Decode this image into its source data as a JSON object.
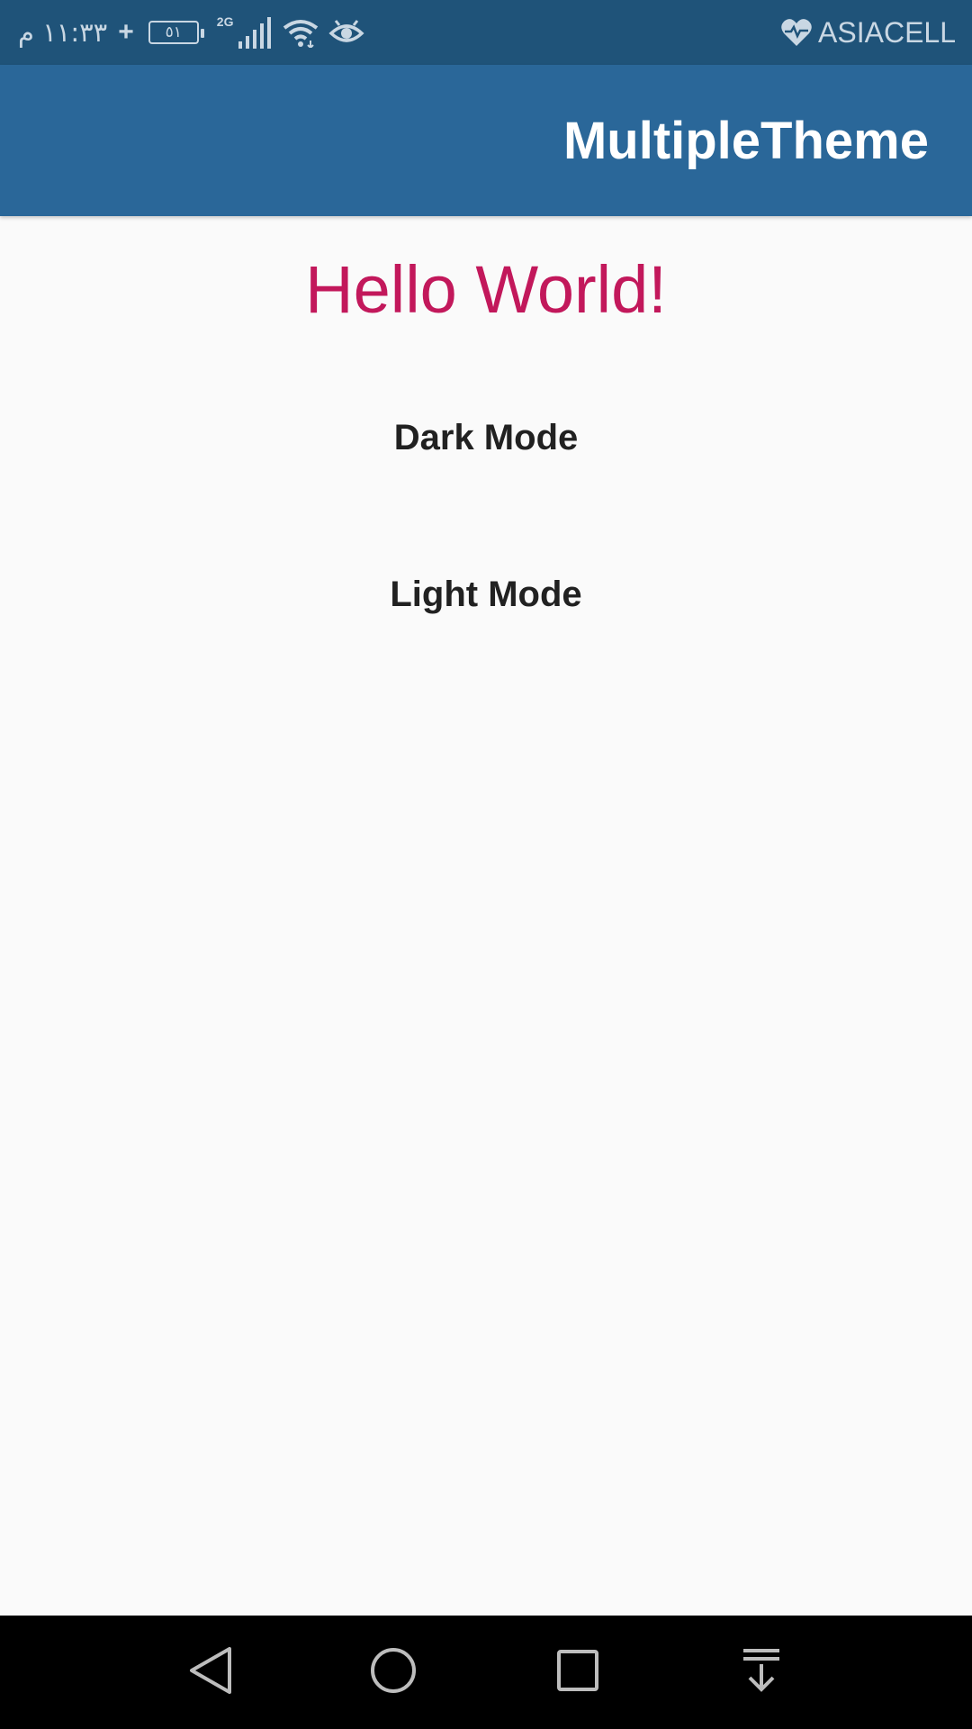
{
  "status_bar": {
    "time": "١١:٣٣ م",
    "plus": "+",
    "battery": "٥١",
    "network": "2G",
    "carrier": "ASIACELL",
    "icons": [
      "battery-icon",
      "signal-icon",
      "wifi-icon",
      "eye-icon",
      "heart-icon"
    ]
  },
  "app_bar": {
    "title": "MultipleTheme"
  },
  "main": {
    "hello": "Hello World!",
    "dark_mode_label": "Dark Mode",
    "light_mode_label": "Light Mode"
  },
  "nav_bar": {
    "buttons": [
      "back-icon",
      "home-icon",
      "recents-icon",
      "notification-pulldown-icon"
    ]
  },
  "colors": {
    "status_bar": "#1f5379",
    "app_bar": "#2a6799",
    "hello_text": "#c2185b",
    "background": "#fafafa",
    "nav_bar": "#000000"
  }
}
